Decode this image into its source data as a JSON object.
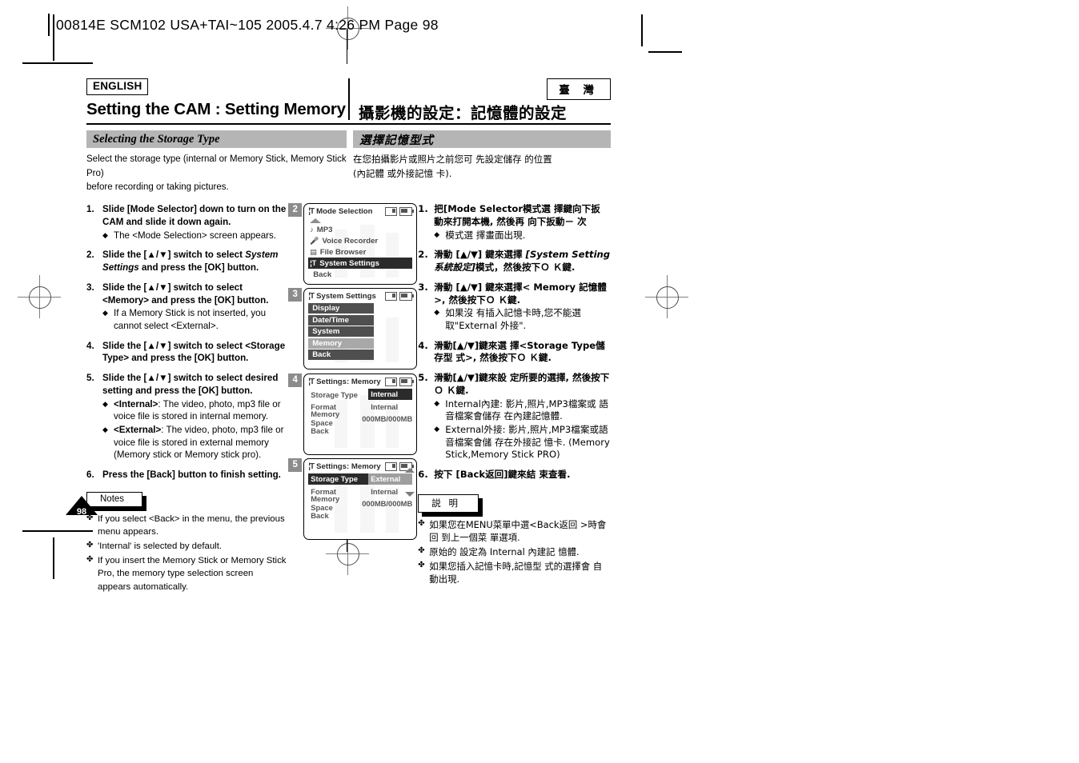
{
  "print_slug": "00814E SCM102 USA+TAI~105 2005.4.7 4:26 PM Page 98",
  "page_number": "98",
  "header": {
    "language_badge": "ENGLISH",
    "region_badge": "臺 灣",
    "title_en": "Setting the CAM : Setting Memory",
    "title_zh": "攝影機的設定：記憶體的設定"
  },
  "section": {
    "heading_en": "Selecting the Storage Type",
    "heading_zh": "選擇記憶型式",
    "intro_en_line1": "Select the storage type (internal or Memory Stick, Memory Stick Pro)",
    "intro_en_line2": "before recording or taking pictures.",
    "intro_zh_line1": "在您拍攝影片或照片之前您可 先設定儲存 的位置",
    "intro_zh_line2": "(內記體 或外接記憶 卡)."
  },
  "steps_en": [
    {
      "num": "1.",
      "text_a": "Slide [Mode Selector] down to turn on the CAM and slide it down again.",
      "bullets": [
        {
          "text": "The <Mode Selection> screen appears."
        }
      ]
    },
    {
      "num": "2.",
      "text_a": "Slide the [▲/▼] switch to select ",
      "italic": "System Settings",
      "text_b": " and press the [OK] button.",
      "bullets": []
    },
    {
      "num": "3.",
      "text_a": "Slide the [▲/▼] switch to select <Memory> and press the [OK] button.",
      "bullets": [
        {
          "text": "If a Memory Stick is not inserted, you cannot select <External>."
        }
      ]
    },
    {
      "num": "4.",
      "text_a": "Slide the [▲/▼] switch to select <Storage Type> and press the [OK] button.",
      "bullets": []
    },
    {
      "num": "5.",
      "text_a": "Slide the [▲/▼] switch to select desired setting and press the [OK] button.",
      "bullets": [
        {
          "bold": "<Internal>",
          "text": ": The video, photo, mp3 file or voice file is stored in internal memory."
        },
        {
          "bold": "<External>",
          "text": ": The video, photo, mp3 file or voice file is stored in external memory (Memory stick or Memory stick pro)."
        }
      ]
    },
    {
      "num": "6.",
      "text_a": "Press the [Back] button to finish setting.",
      "bullets": []
    }
  ],
  "notes_en": {
    "title": "Notes",
    "items": [
      "If you select <Back> in the menu, the previous menu appears.",
      "'Internal' is selected by default.",
      "If you insert the Memory Stick or Memory Stick Pro, the memory type selection screen appears automatically."
    ]
  },
  "steps_zh": [
    {
      "num": "1.",
      "text_a": "把[Mode Selector模式選 擇鍵向下扳 動來打開本機, 然後再 向下扳動－ 次",
      "bullets": [
        {
          "text": "模式選 擇畫面出現."
        }
      ]
    },
    {
      "num": "2.",
      "text_a": "滑動 [▲/▼] 鍵來選擇 ",
      "italic": "[System Setting 系統設定]",
      "text_b": "模式，然後按下Ｏ Ｋ鍵.",
      "bullets": []
    },
    {
      "num": "3.",
      "text_a": "滑動 [▲/▼] 鍵來選擇< Memory 記憶體 >, 然後按下Ｏ Ｋ鍵.",
      "bullets": [
        {
          "text": "如果沒 有插入記憶卡時,您不能選取\"External 外接\"."
        }
      ]
    },
    {
      "num": "4.",
      "text_a": "滑動[▲/▼]鍵來選 擇<Storage Type儲存型 式>, 然後按下Ｏ Ｋ鍵.",
      "bullets": []
    },
    {
      "num": "5.",
      "text_a": "滑動[▲/▼]鍵來設 定所要的選擇, 然後按下 Ｏ Ｋ鍵.",
      "bullets": [
        {
          "text": "Internal內建: 影片,照片,MP3檔案或 語音檔案會儲存 在內建記憶體."
        },
        {
          "text": "External外接: 影片,照片,MP3檔案或語音檔案會儲 存在外接記 憶卡. (Memory Stick,Memory Stick PRO)"
        }
      ]
    },
    {
      "num": "6.",
      "text_a": "按下 [Back返回]鍵來結 束查看.",
      "bullets": []
    }
  ],
  "notes_zh": {
    "title": "説 明",
    "items": [
      "如果您在MENU菜單中選<Back返回 >時會回 到上一個菜 單選項.",
      "原始的 設定為 Internal 內建記 憶體.",
      "如果您插入記憶卡時,記憶型 式的選擇會 自動出現."
    ]
  },
  "lcd_screens": [
    {
      "step": "2",
      "title": "Mode Selection",
      "title_icon": "settings-icon",
      "status_icons": [
        "memory-card-icon",
        "battery-icon"
      ],
      "has_up_arrow": true,
      "rows": [
        {
          "icon": "music-note-icon",
          "label": "MP3",
          "state": "normal"
        },
        {
          "icon": "microphone-icon",
          "label": "Voice Recorder",
          "state": "normal"
        },
        {
          "icon": "file-browser-icon",
          "label": "File Browser",
          "state": "normal"
        },
        {
          "icon": "settings-icon",
          "label": "System Settings",
          "state": "selected"
        },
        {
          "icon": "",
          "label": "Back",
          "state": "normal"
        }
      ]
    },
    {
      "step": "3",
      "title": "System Settings",
      "title_icon": "settings-icon",
      "status_icons": [
        "memory-card-icon",
        "battery-icon"
      ],
      "bars": [
        {
          "label": "Display",
          "state": "normal"
        },
        {
          "label": "Date/Time",
          "state": "normal"
        },
        {
          "label": "System",
          "state": "normal"
        },
        {
          "label": "Memory",
          "state": "highlight"
        },
        {
          "label": "Back",
          "state": "normal"
        }
      ]
    },
    {
      "step": "4",
      "title": "Settings: Memory",
      "title_icon": "settings-icon",
      "status_icons": [
        "memory-card-icon",
        "battery-icon"
      ],
      "kv": [
        {
          "key": "Storage Type",
          "value": "Internal",
          "style": "value-dark"
        },
        {
          "key": "Format",
          "value": "Internal",
          "style": "plain"
        },
        {
          "key": "Memory Space",
          "value": "000MB/000MB",
          "style": "plain"
        },
        {
          "key": "Back",
          "value": "",
          "style": "plain"
        }
      ],
      "arrows": false
    },
    {
      "step": "5",
      "title": "Settings: Memory",
      "title_icon": "settings-icon",
      "status_icons": [
        "memory-card-icon",
        "battery-icon"
      ],
      "kv": [
        {
          "key": "Storage Type",
          "value": "External",
          "style": "key-dark-value-gray"
        },
        {
          "key": "Format",
          "value": "Internal",
          "style": "plain"
        },
        {
          "key": "Memory Space",
          "value": "000MB/000MB",
          "style": "plain"
        },
        {
          "key": "Back",
          "value": "",
          "style": "plain"
        }
      ],
      "arrows": true
    }
  ],
  "colors": {
    "band_gray": "#b5b5b5",
    "step_tag_gray": "#8c8c8c",
    "lcd_selected": "#2b2b2b",
    "lcd_bar": "#4f4f4f",
    "lcd_highlight": "#a8a8a8"
  }
}
